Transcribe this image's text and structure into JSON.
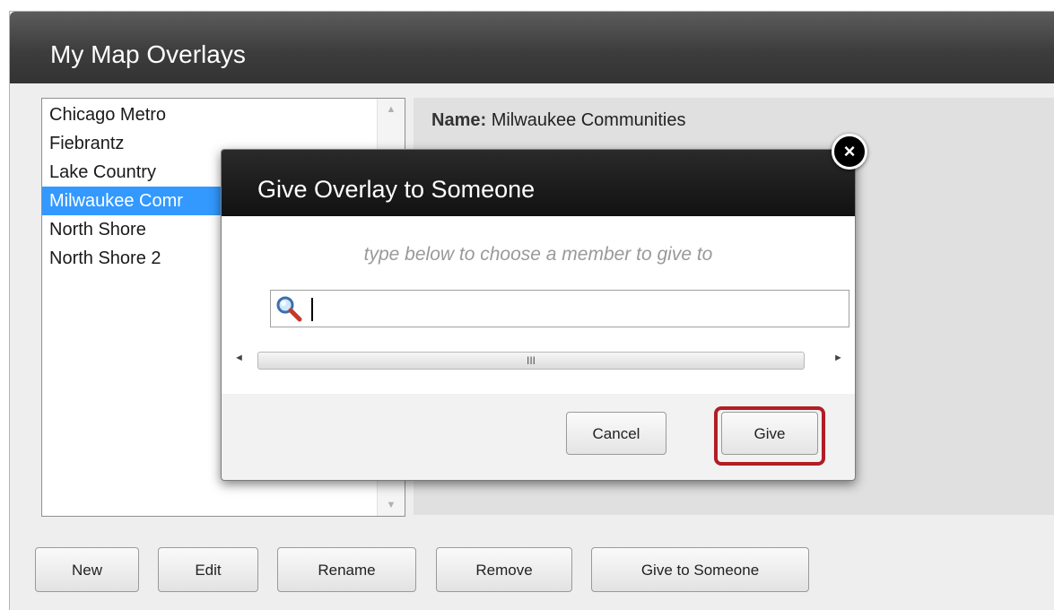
{
  "window": {
    "title": "My Map Overlays"
  },
  "overlay_list": {
    "items": [
      {
        "label": "Chicago Metro",
        "selected": false
      },
      {
        "label": "Fiebrantz",
        "selected": false
      },
      {
        "label": "Lake Country",
        "selected": false
      },
      {
        "label": "Milwaukee Comr",
        "selected": true
      },
      {
        "label": "North Shore",
        "selected": false
      },
      {
        "label": "North Shore 2",
        "selected": false
      }
    ]
  },
  "details": {
    "name_label": "Name:",
    "name_value": "Milwaukee Communities"
  },
  "toolbar": {
    "new_label": "New",
    "edit_label": "Edit",
    "rename_label": "Rename",
    "remove_label": "Remove",
    "give_label": "Give to Someone"
  },
  "dialog": {
    "title": "Give Overlay to Someone",
    "hint": "type below to choose a member to give to",
    "search_value": "",
    "scroll_grip": "III",
    "cancel_label": "Cancel",
    "give_label": "Give",
    "close_symbol": "×"
  },
  "colors": {
    "selection": "#3399ff",
    "highlight_border": "#b01e24",
    "header_dark": "#111111"
  }
}
